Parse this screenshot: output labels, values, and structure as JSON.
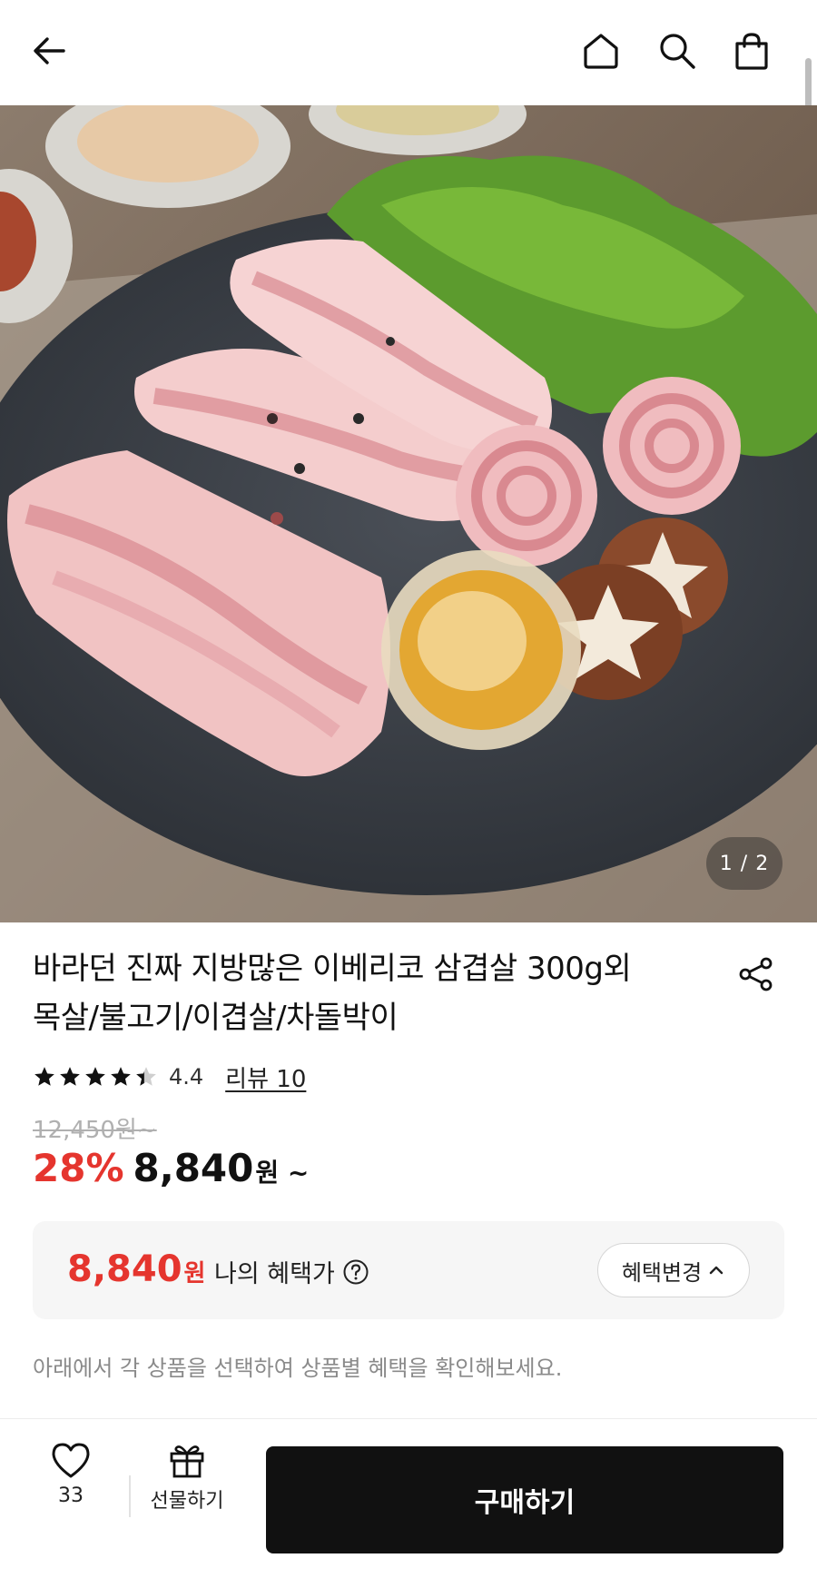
{
  "header": {
    "icons": [
      "back-arrow-icon",
      "home-icon",
      "search-icon",
      "shopping-bag-icon"
    ]
  },
  "hero": {
    "pager": "1 / 2"
  },
  "product": {
    "title_line1": "바라던 진짜 지방많은 이베리코 삼겹살 300g외",
    "title_line2": "목살/불고기/이겹살/차돌박이",
    "rating": 4.4,
    "rating_text": "4.4",
    "review_link": "리뷰 10",
    "original_price": "12,450원~",
    "discount": "28%",
    "price": "8,840",
    "price_unit": "원 ~"
  },
  "benefit": {
    "price": "8,840",
    "unit": "원",
    "label": "나의 혜택가",
    "change_button": "혜택변경",
    "hint": "아래에서 각 상품을 선택하여 상품별 혜택을 확인해보세요."
  },
  "bottom": {
    "like_count": "33",
    "gift_label": "선물하기",
    "buy_label": "구매하기"
  },
  "colors": {
    "accent_red": "#e5352e",
    "buy_button": "#111111"
  }
}
